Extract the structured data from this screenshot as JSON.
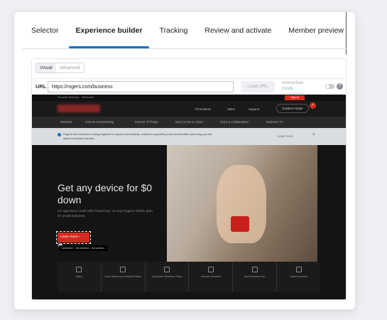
{
  "tabs": [
    {
      "label": "Selector"
    },
    {
      "label": "Experience builder"
    },
    {
      "label": "Tracking"
    },
    {
      "label": "Review and activate"
    },
    {
      "label": "Member preview"
    }
  ],
  "mode_toggle": {
    "visual": "Visual",
    "advanced": "Advanced"
  },
  "url_bar": {
    "label": "URL",
    "value": "https://rogers.com/business",
    "load_button": "Load URL",
    "interactive_mode": "Interactive mode",
    "help": "?"
  },
  "site": {
    "top_links": [
      "Personal",
      "Business",
      "Wholesale"
    ],
    "sign_in": "Sign In",
    "nav_links": [
      "Promotions",
      "Sales",
      "Support"
    ],
    "solution_finder": "Solution Finder",
    "badge": "✓",
    "sub_nav": [
      "Wireless",
      "Internet & Networking",
      "Internet of Things",
      "Data Centre & Cloud",
      "Voice & Collaboration",
      "Business TV"
    ],
    "banner_text": "Rogers and Oneview coming together to expand connectivity, continue supporting local communities and bring you the latest innovative bundles.",
    "banner_link": "Learn more",
    "hero_title": "Get any device for $0 down",
    "hero_sub": "On approved credit with Financing† on any Rogers Infinite plan for small business.",
    "learn_more": "Learn more  ›",
    "crumb": "container > div.section > div.section",
    "tiles": [
      "Offers",
      "Small Business Wireless Plans",
      "Corporate Wireless Plans",
      "Internet Services",
      "My Business Hub",
      "Latest Devices"
    ]
  }
}
